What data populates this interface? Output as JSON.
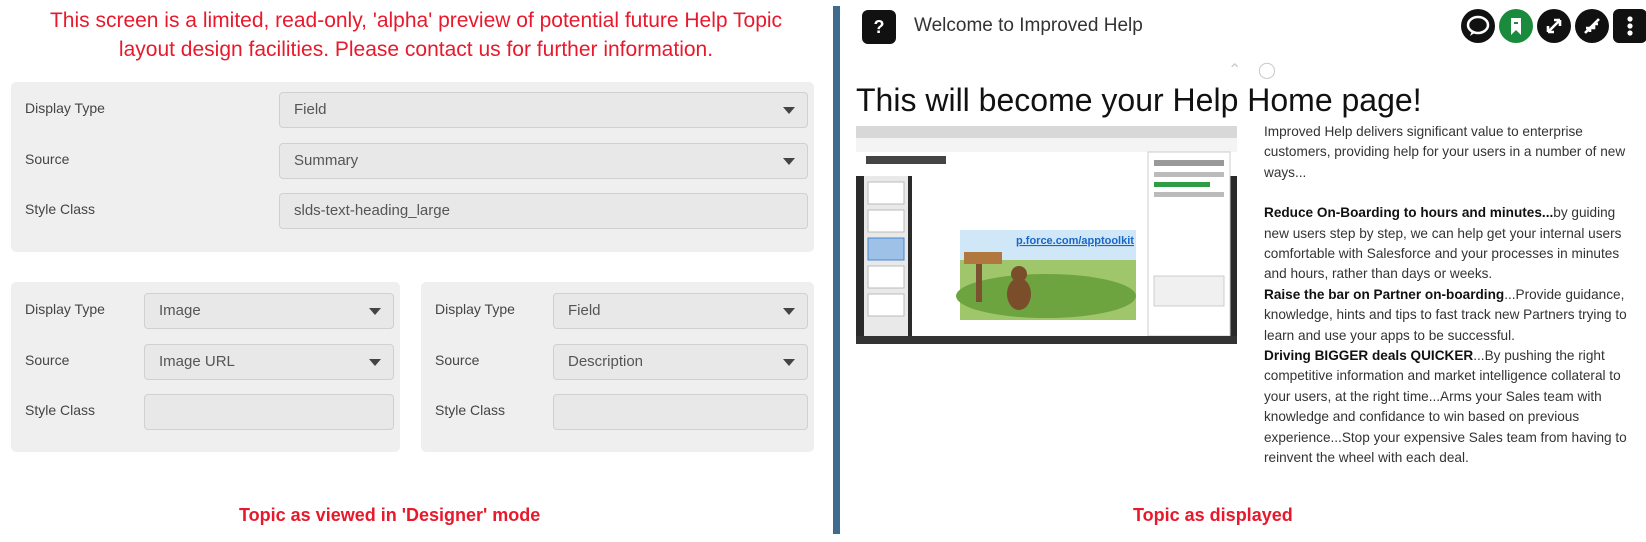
{
  "designer": {
    "notice_line1": "This screen is a limited, read-only, 'alpha' preview of potential future Help Topic",
    "notice_line2": "layout design facilities. Please contact us for further information.",
    "top_card": {
      "display_type_label": "Display Type",
      "display_type_value": "Field",
      "source_label": "Source",
      "source_value": "Summary",
      "style_class_label": "Style Class",
      "style_class_value": "slds-text-heading_large"
    },
    "left_card": {
      "display_type_label": "Display Type",
      "display_type_value": "Image",
      "source_label": "Source",
      "source_value": "Image URL",
      "style_class_label": "Style Class",
      "style_class_value": ""
    },
    "right_card": {
      "display_type_label": "Display Type",
      "display_type_value": "Field",
      "source_label": "Source",
      "source_value": "Description",
      "style_class_label": "Style Class",
      "style_class_value": ""
    },
    "caption": "Topic as viewed in 'Designer' mode"
  },
  "preview": {
    "help_button": "?",
    "window_title": "Welcome to Improved Help",
    "toolbar_icons": [
      "chat-icon",
      "bookmark-icon",
      "expand-icon",
      "collapse-icon",
      "more-vertical-icon"
    ],
    "accent_green": "#1a8a3c",
    "home_title": "This will become your Help Home page!",
    "screenshot_link": "p.force.com/apptoolkit",
    "intro": "Improved Help delivers significant value to enterprise customers, providing help for your users in a number of new ways...",
    "p1_bold": "Reduce On-Boarding to hours and minutes...",
    "p1_text": "by guiding new users step by step, we can help get your internal users comfortable with Salesforce and your processes in minutes and hours, rather than days or weeks.",
    "p2_bold": "Raise the bar on Partner on-boarding",
    "p2_text": "...Provide guidance, knowledge, hints and tips to fast track new Partners trying to learn and use your apps to be successful.",
    "p3_bold": "Driving BIGGER deals QUICKER",
    "p3_text": "...By pushing the right competitive information and market intelligence collateral to your users, at the right time...Arms your Sales team with knowledge and confidance to win based on previous experience...Stop your expensive Sales team from having to reinvent the wheel with each deal.",
    "caption": "Topic as displayed"
  }
}
